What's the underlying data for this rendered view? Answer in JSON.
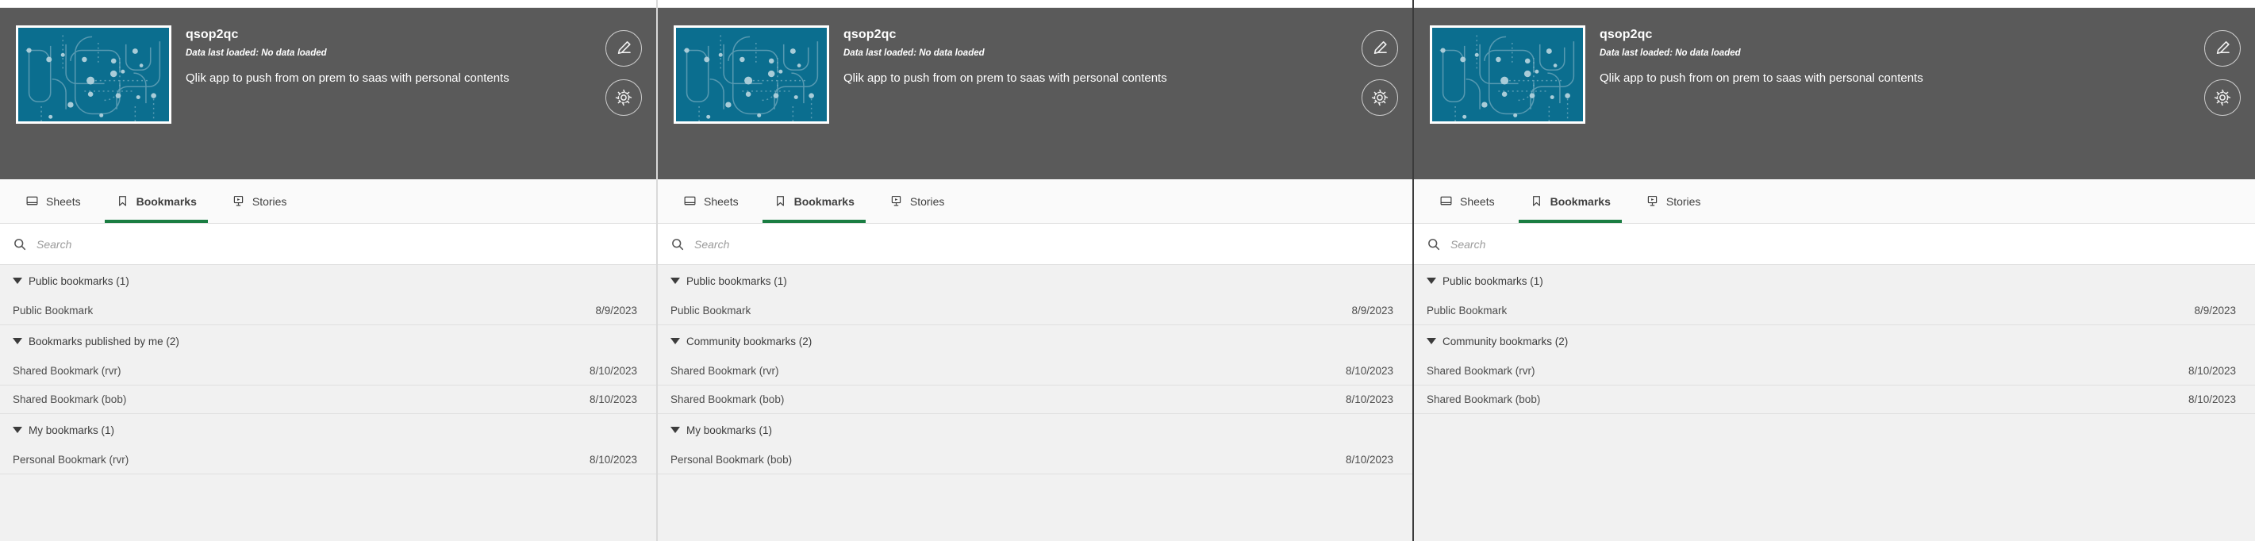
{
  "panels": [
    {
      "app": {
        "title": "qsop2qc",
        "subtitle": "Data last loaded: No data loaded",
        "description": "Qlik app to push from on prem to saas with personal contents"
      },
      "actions": {
        "edit_label": "Edit",
        "settings_label": "Settings"
      },
      "tabs": [
        {
          "label": "Sheets",
          "icon": "sheets-icon",
          "active": false
        },
        {
          "label": "Bookmarks",
          "icon": "bookmark-icon",
          "active": true
        },
        {
          "label": "Stories",
          "icon": "stories-icon",
          "active": false
        }
      ],
      "search": {
        "value": "",
        "placeholder": "Search"
      },
      "groups": [
        {
          "label": "Public bookmarks (1)",
          "items": [
            {
              "name": "Public Bookmark",
              "date": "8/9/2023"
            }
          ]
        },
        {
          "label": "Bookmarks published by me (2)",
          "items": [
            {
              "name": "Shared Bookmark (rvr)",
              "date": "8/10/2023"
            },
            {
              "name": "Shared Bookmark (bob)",
              "date": "8/10/2023"
            }
          ]
        },
        {
          "label": "My bookmarks (1)",
          "items": [
            {
              "name": "Personal Bookmark (rvr)",
              "date": "8/10/2023"
            }
          ]
        }
      ]
    },
    {
      "app": {
        "title": "qsop2qc",
        "subtitle": "Data last loaded: No data loaded",
        "description": "Qlik app to push from on prem to saas with personal contents"
      },
      "actions": {
        "edit_label": "Edit",
        "settings_label": "Settings"
      },
      "tabs": [
        {
          "label": "Sheets",
          "icon": "sheets-icon",
          "active": false
        },
        {
          "label": "Bookmarks",
          "icon": "bookmark-icon",
          "active": true
        },
        {
          "label": "Stories",
          "icon": "stories-icon",
          "active": false
        }
      ],
      "search": {
        "value": "",
        "placeholder": "Search"
      },
      "groups": [
        {
          "label": "Public bookmarks (1)",
          "items": [
            {
              "name": "Public Bookmark",
              "date": "8/9/2023"
            }
          ]
        },
        {
          "label": "Community bookmarks (2)",
          "items": [
            {
              "name": "Shared Bookmark (rvr)",
              "date": "8/10/2023"
            },
            {
              "name": "Shared Bookmark (bob)",
              "date": "8/10/2023"
            }
          ]
        },
        {
          "label": "My bookmarks (1)",
          "items": [
            {
              "name": "Personal Bookmark (bob)",
              "date": "8/10/2023"
            }
          ]
        }
      ]
    },
    {
      "app": {
        "title": "qsop2qc",
        "subtitle": "Data last loaded: No data loaded",
        "description": "Qlik app to push from on prem to saas with personal contents"
      },
      "actions": {
        "edit_label": "Edit",
        "settings_label": "Settings"
      },
      "tabs": [
        {
          "label": "Sheets",
          "icon": "sheets-icon",
          "active": false
        },
        {
          "label": "Bookmarks",
          "icon": "bookmark-icon",
          "active": true
        },
        {
          "label": "Stories",
          "icon": "stories-icon",
          "active": false
        }
      ],
      "search": {
        "value": "",
        "placeholder": "Search"
      },
      "groups": [
        {
          "label": "Public bookmarks (1)",
          "items": [
            {
              "name": "Public Bookmark",
              "date": "8/9/2023"
            }
          ]
        },
        {
          "label": "Community bookmarks (2)",
          "items": [
            {
              "name": "Shared Bookmark (rvr)",
              "date": "8/10/2023"
            },
            {
              "name": "Shared Bookmark (bob)",
              "date": "8/10/2023"
            }
          ]
        }
      ]
    }
  ],
  "colors": {
    "header_bg": "#5a5a5a",
    "thumbnail_bg": "#0b6e8f",
    "active_tab_underline": "#1a7d42",
    "list_bg": "#f1f1f1",
    "row_divider": "#dfdfdf"
  }
}
